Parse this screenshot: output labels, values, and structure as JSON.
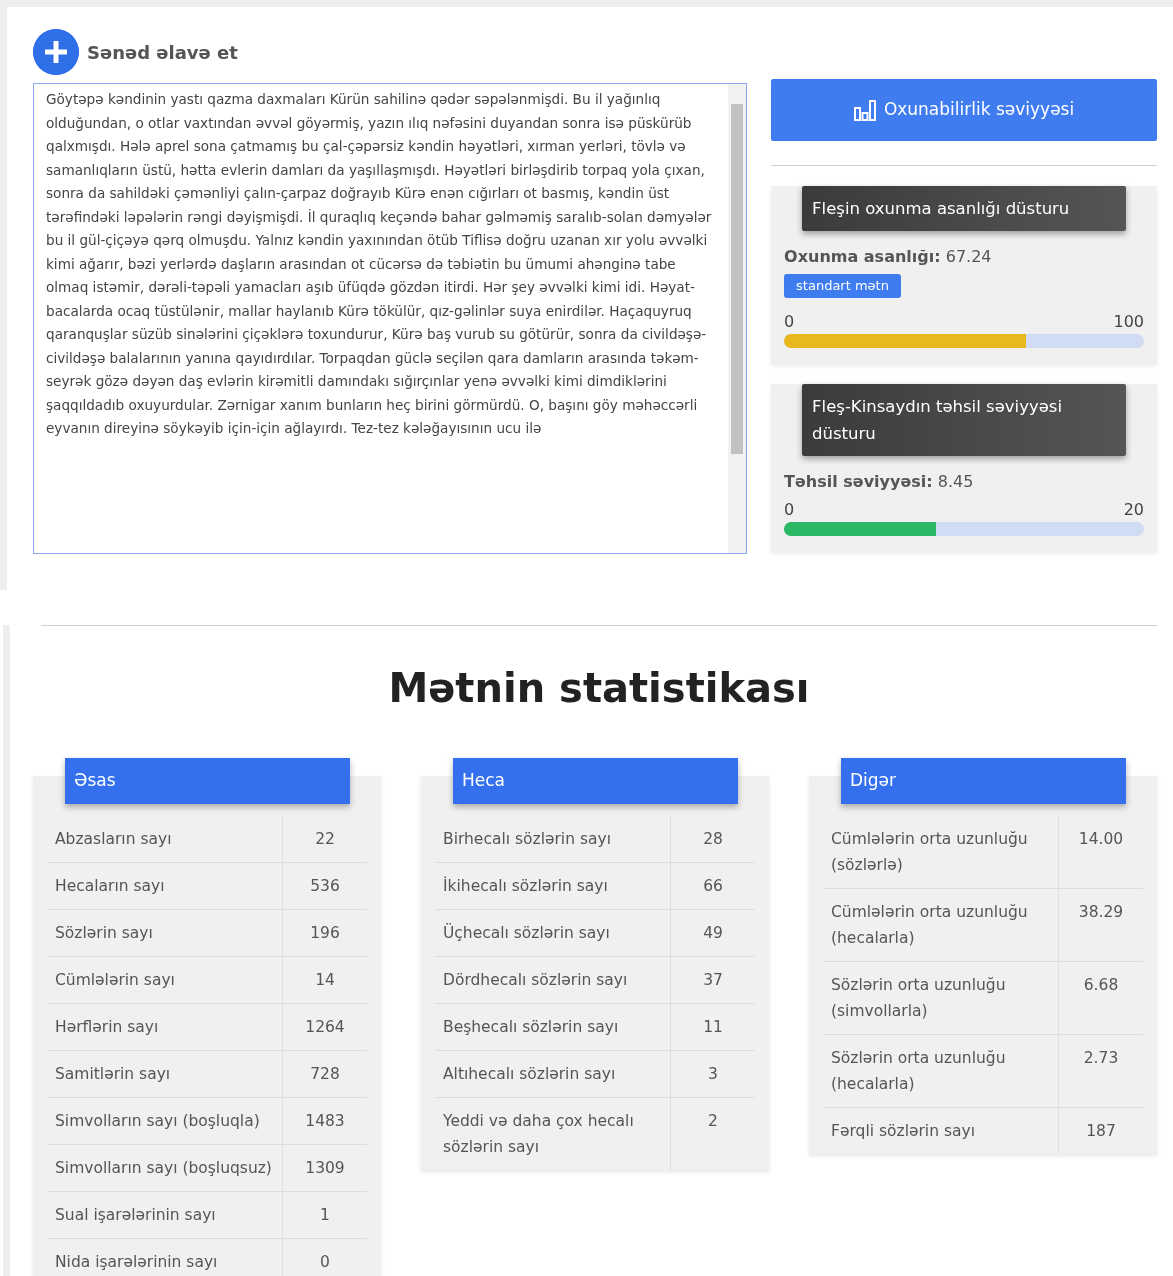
{
  "add_document": {
    "label": "Sənəd əlavə et"
  },
  "text_input": {
    "value": "Göytəpə kəndinin yastı qazma daxmaları Kürün sahilinə qədər səpələnmişdi. Bu il yağınlıq olduğundan, o otlar vaxtından əvvəl göyərmiş, yazın ılıq nəfəsini duyandan sonra isə püskürüb qalxmışdı. Hələ aprel sona çatmamış bu çal-çəpərsiz kəndin həyətləri, xırman yerləri, tövlə və samanlıqların üstü, hətta evlerin damları da yaşıllaşmışdı. Həyətləri birləşdirib torpaq yola çıxan, sonra da sahildəki çəmənliyi çalın-çarpaz doğrayıb Kürə enən cığırları ot basmış, kəndin üst tərəfindəki ləpələrin rəngi dəyişmişdi. İl quraqlıq keçəndə bahar gəlməmiş saralıb-solan dəmyələr bu il gül-çiçəyə qərq olmuşdu. Yalnız kəndin yaxınından ötüb Tiflisə doğru uzanan xır yolu əvvəlki kimi ağarır, bəzi yerlərdə daşların arasından ot cücərsə də təbiətin bu ümumi ahənginə tabe olmaq istəmir, dərəli-təpəli yamacları aşıb üfüqdə gözdən itirdi. Hər şey əvvəlki kimi idi. Həyat-bacalarda ocaq tüstülənir, mallar haylanıb Kürə tökülür, qız-gəlinlər suya enirdilər. Haçaquyruq qaranquşlar süzüb sinələrini çiçəklərə toxundurur, Kürə baş vurub su götürür, sonra da civildəşə-civildəşə balalarının yanına qayıdırdılar. Torpaqdan güclə seçilən qara damların arasında təkəm-seyrək gözə dəyən daş evlərin kirəmitli damındakı sığırçınlar yenə əvvəlki kimi dimdiklərini şaqqıldadıb oxuyurdular. Zərnigar xanım bunların heç birini görmürdü. O, başını göy məhəccərli eyvanın direyinə söykəyib için-için ağlayırdı. Tez-tez kələğayısının ucu ilə"
  },
  "readability_button": {
    "label": "Oxunabilirlik səviyyəsi"
  },
  "meters": [
    {
      "title": "Fleşin oxunma asanlığı düsturu",
      "label": "Oxunma asanlığı:",
      "reading": "67.24",
      "badge": "standart mətn",
      "min": "0",
      "max": "100",
      "level": 0.6724,
      "color": "#e8b81c"
    },
    {
      "title": "Fleş-Kinsaydın təhsil səviyyəsi düsturu",
      "label": "Təhsil səviyyəsi:",
      "reading": "8.45",
      "min": "0",
      "max": "20",
      "level": 0.4225,
      "color": "#2bb764"
    }
  ],
  "stats_title": "Mətnin statistikası",
  "stat_cards": [
    {
      "title": "Əsas",
      "rows": [
        [
          "Abzasların sayı",
          "22"
        ],
        [
          "Hecaların sayı",
          "536"
        ],
        [
          "Sözlərin sayı",
          "196"
        ],
        [
          "Cümlələrin sayı",
          "14"
        ],
        [
          "Hərflərin sayı",
          "1264"
        ],
        [
          "Samitlərin sayı",
          "728"
        ],
        [
          "Simvolların sayı (boşluqla)",
          "1483"
        ],
        [
          "Simvolların sayı (boşluqsuz)",
          "1309"
        ],
        [
          "Sual işarələrinin sayı",
          "1"
        ],
        [
          "Nida işarələrinin sayı",
          "0"
        ]
      ]
    },
    {
      "title": "Heca",
      "rows": [
        [
          "Birhecalı sözlərin sayı",
          "28"
        ],
        [
          "İkihecalı sözlərin sayı",
          "66"
        ],
        [
          "Üçhecalı sözlərin sayı",
          "49"
        ],
        [
          "Dördhecalı sözlərin sayı",
          "37"
        ],
        [
          "Beşhecalı sözlərin sayı",
          "11"
        ],
        [
          "Altıhecalı sözlərin sayı",
          "3"
        ],
        [
          "Yeddi və daha çox hecalı sözlərin sayı",
          "2"
        ]
      ]
    },
    {
      "title": "Digər",
      "rows": [
        [
          "Cümlələrin orta uzunluğu (sözlərlə)",
          "14.00"
        ],
        [
          "Cümlələrin orta uzunluğu (hecalarla)",
          "38.29"
        ],
        [
          "Sözlərin orta uzunluğu (simvollarla)",
          "6.68"
        ],
        [
          "Sözlərin orta uzunluğu (hecalarla)",
          "2.73"
        ],
        [
          "Fərqli sözlərin sayı",
          "187"
        ]
      ]
    }
  ]
}
